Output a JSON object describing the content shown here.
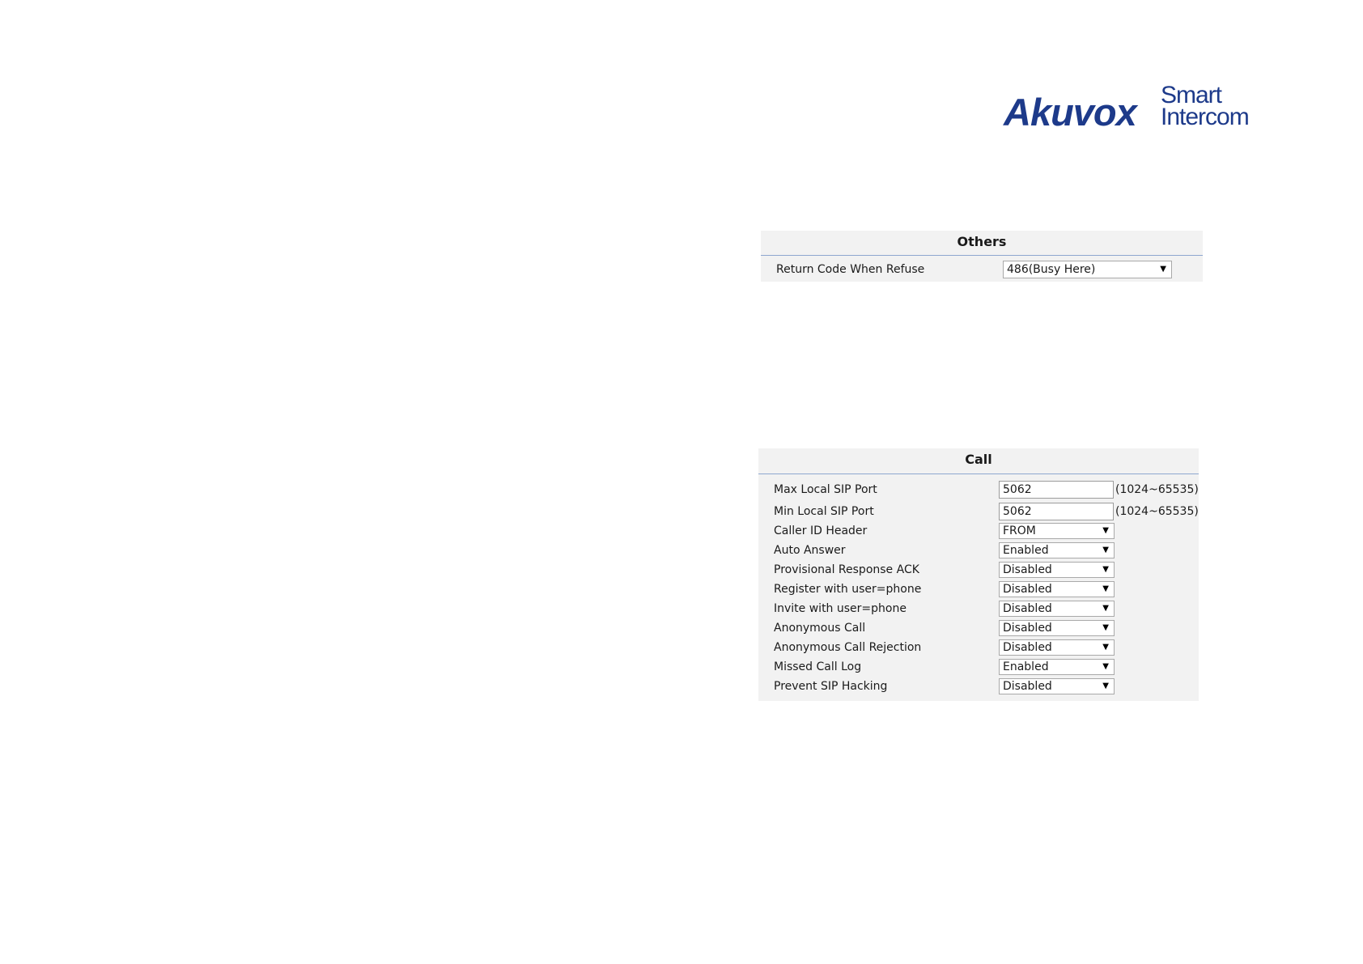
{
  "logo": {
    "brand": "Akuvox",
    "tagline_line1": "Smart",
    "tagline_line2": "Intercom"
  },
  "others": {
    "title": "Others",
    "rows": [
      {
        "label": "Return Code When Refuse",
        "value": "486(Busy Here)"
      }
    ]
  },
  "call": {
    "title": "Call",
    "rows": [
      {
        "label": "Max Local SIP Port",
        "value": "5062",
        "note": "(1024~65535)"
      },
      {
        "label": "Min Local SIP Port",
        "value": "5062",
        "note": "(1024~65535)"
      },
      {
        "label": "Caller ID Header",
        "value": "FROM"
      },
      {
        "label": "Auto Answer",
        "value": "Enabled"
      },
      {
        "label": "Provisional Response ACK",
        "value": "Disabled"
      },
      {
        "label": "Register with user=phone",
        "value": "Disabled"
      },
      {
        "label": "Invite with user=phone",
        "value": "Disabled"
      },
      {
        "label": "Anonymous Call",
        "value": "Disabled"
      },
      {
        "label": "Anonymous Call Rejection",
        "value": "Disabled"
      },
      {
        "label": "Missed Call Log",
        "value": "Enabled"
      },
      {
        "label": "Prevent SIP Hacking",
        "value": "Disabled"
      }
    ]
  },
  "icons": {
    "dropdown": "chevron-down-icon"
  },
  "colors": {
    "brand": "#1d3a8a",
    "panel_bg": "#f2f2f2",
    "header_rule": "#8ea7cf"
  }
}
